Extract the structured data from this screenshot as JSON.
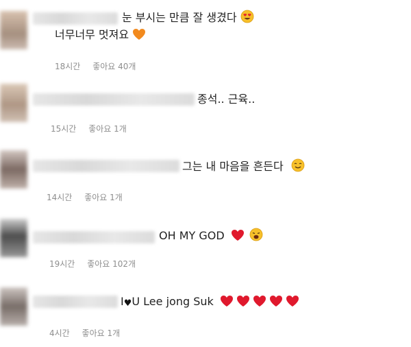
{
  "comments": [
    {
      "line1": "눈 부시는 만큼 잘 생겼다",
      "line2": "너무너무 멋져요",
      "time": "18시간",
      "likes": "좋아요 40개"
    },
    {
      "line1": "종석.. 근육..",
      "time": "15시간",
      "likes": "좋아요 1개"
    },
    {
      "line1": "그는 내 마음을 흔든다",
      "time": "14시간",
      "likes": "좋아요 1개"
    },
    {
      "line1": "OH MY GOD",
      "time": "19시간",
      "likes": "좋아요 102개"
    },
    {
      "line1_prefix": "I",
      "line1_suffix": "U Lee jong Suk",
      "time": "4시간",
      "likes": "좋아요 1개"
    }
  ],
  "icons": {
    "heart_eyes": "heart-eyes-emoji",
    "orange_heart": "orange-heart-emoji",
    "red_heart": "red-heart-emoji",
    "smile": "smiling-face-emoji",
    "weary": "weary-face-emoji",
    "black_heart": "black-heart-emoji"
  }
}
